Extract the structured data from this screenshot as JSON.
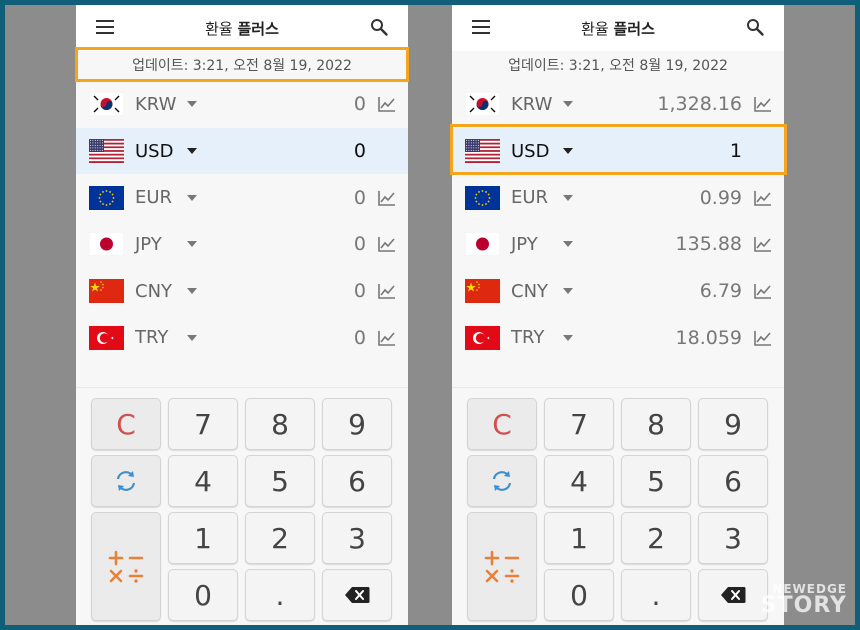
{
  "app": {
    "title_prefix": "환율 ",
    "title_bold": "플러스",
    "update_text": "업데이트: 3:21, 오전 8월 19, 2022"
  },
  "left": {
    "rows": [
      {
        "code": "KRW",
        "flag": "kr",
        "value": "0",
        "selected": false
      },
      {
        "code": "USD",
        "flag": "us",
        "value": "0",
        "selected": true
      },
      {
        "code": "EUR",
        "flag": "eu",
        "value": "0",
        "selected": false
      },
      {
        "code": "JPY",
        "flag": "jp",
        "value": "0",
        "selected": false
      },
      {
        "code": "CNY",
        "flag": "cn",
        "value": "0",
        "selected": false
      },
      {
        "code": "TRY",
        "flag": "tr",
        "value": "0",
        "selected": false
      }
    ]
  },
  "right": {
    "rows": [
      {
        "code": "KRW",
        "flag": "kr",
        "value": "1,328.16",
        "selected": false
      },
      {
        "code": "USD",
        "flag": "us",
        "value": "1",
        "selected": true
      },
      {
        "code": "EUR",
        "flag": "eu",
        "value": "0.99",
        "selected": false
      },
      {
        "code": "JPY",
        "flag": "jp",
        "value": "135.88",
        "selected": false
      },
      {
        "code": "CNY",
        "flag": "cn",
        "value": "6.79",
        "selected": false
      },
      {
        "code": "TRY",
        "flag": "tr",
        "value": "18.059",
        "selected": false
      }
    ]
  },
  "keypad": {
    "clear": "C",
    "k7": "7",
    "k8": "8",
    "k9": "9",
    "k4": "4",
    "k5": "5",
    "k6": "6",
    "k1": "1",
    "k2": "2",
    "k3": "3",
    "k0": "0",
    "dot": "."
  },
  "icons": {
    "menu": "menu-icon",
    "search": "search-icon",
    "chart": "chart-line-icon",
    "refresh": "refresh-icon",
    "operators": "operators-icon",
    "backspace": "backspace-icon"
  },
  "colors": {
    "highlight": "#f5a51c",
    "selected_row": "#e6f0fa",
    "clear_key": "#d05050",
    "operators": "#e8823a",
    "refresh": "#3b8fd0"
  },
  "watermark": {
    "line1": "NEWEDGE",
    "line2": "STORY"
  }
}
